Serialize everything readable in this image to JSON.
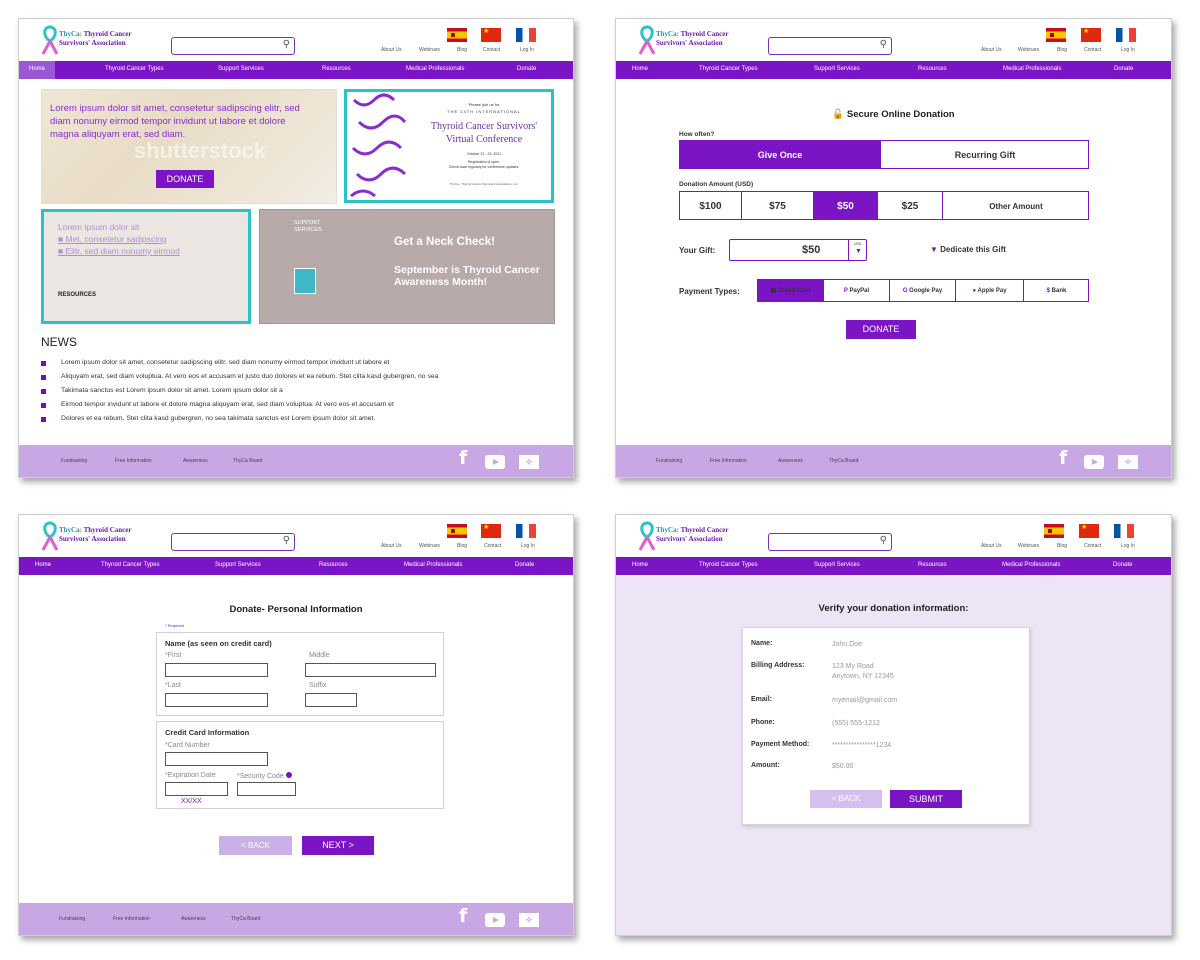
{
  "brand": {
    "logo_line1_a": "ThyCa:",
    "logo_line1_b": "Thyroid Cancer",
    "logo_line2": "Survivors' Association"
  },
  "header": {
    "links": [
      "About Us",
      "Webinars",
      "Blog",
      "Contact",
      "Log In"
    ],
    "flags": [
      "spain-flag",
      "china-flag",
      "france-flag"
    ]
  },
  "nav": {
    "items": [
      "Home",
      "Thyroid Cancer Types",
      "Support Services",
      "Resources",
      "Medical Professionals",
      "Donate"
    ]
  },
  "footer": {
    "links": [
      "Fundraising",
      "Free Information",
      "Awareness",
      "ThyCa Board"
    ],
    "social_icons": [
      "facebook-icon",
      "youtube-icon",
      "twitter-icon"
    ]
  },
  "home": {
    "hero_text": "Lorem ipsum dolor sit amet, consetetur sadipscing elitr, sed diam nonumy eirmod tempor invidunt ut labore et dolore magna aliquyam erat, sed diam.",
    "watermark": "shutterstock",
    "donate": "DONATE",
    "conf_line1": "Please join us for",
    "conf_line2": "THE 24TH INTERNATIONAL",
    "conf_title": "Thyroid Cancer Survivors' Virtual Conference",
    "conf_dates": "October 22 - 24, 2021",
    "conf_reg": "Registration is open.\nCheck back regularly for conference updates.",
    "conf_foot": "ThyCa - Thyroid Cancer Survivors' Association, Inc.",
    "res_line1": "Lorem ipsum dolor sit",
    "res_link1": "Met, consetetur sadipscing",
    "res_link2": "Elitr, sed diam nonumy eirmod",
    "res_label": "RESOURCES",
    "support_label": "SUPPORT SERVICES",
    "neck_check": "Get a Neck Check!",
    "awareness": "September is Thyroid Cancer Awareness Month!",
    "news_title": "NEWS",
    "news": [
      "Lorem ipsum dolor sit amet, consetetur sadipscing elitr, sed diam nonumy eirmod tempor invidunt ut labore et",
      "Aliquyam erat, sed diam voluptua. At vero eos et accusam et justo duo dolores et ea rebum. Stet clita kasd gubergren, no sea",
      "Takimata sanctus est Lorem ipsum dolor sit amet. Lorem ipsum dolor sit a",
      "Eirmod tempor invidunt ut labore et dolore magna aliquyam erat, sed diam voluptua. At vero eos et accusam et",
      "Dolores et ea rebum. Stet clita kasd gubergren, no sea takimata sanctus est Lorem ipsum dolor sit amet."
    ]
  },
  "donate": {
    "title": "Secure Online Donation",
    "how_often": "How often?",
    "frequency": [
      "Give Once",
      "Recurring Gift"
    ],
    "amount_label": "Donation Amount (USD)",
    "amounts": [
      "$100",
      "$75",
      "$50",
      "$25",
      "Other Amount"
    ],
    "selected_amount": "$50",
    "your_gift_label": "Your Gift:",
    "gift_value": "$50",
    "currency": "USD",
    "dedicate": "Dedicate this Gift",
    "payment_label": "Payment Types:",
    "payment_types": [
      "Credit Card",
      "PayPal",
      "Google Pay",
      "Apple Pay",
      "Bank"
    ],
    "button": "DONATE"
  },
  "personal": {
    "title": "Donate- Personal Information",
    "required": "* Required",
    "name_header": "Name (as seen on credit card)",
    "first": "*First",
    "middle": "Middle",
    "last": "*Last",
    "suffix": "Suffix",
    "card_header": "Credit Card Information",
    "card_number": "*Card Number",
    "expiration": "*Expiration Date",
    "security": "*Security Code",
    "exp_placeholder": "XX/XX",
    "back": "< BACK",
    "next": "NEXT >"
  },
  "verify": {
    "title": "Verify your donation information:",
    "rows": [
      {
        "label": "Name:",
        "value": "John Doe"
      },
      {
        "label": "Billing Address:",
        "value": "123 My Road\nAnytown, NY 12345"
      },
      {
        "label": "Email:",
        "value": "myemail@gmail.com"
      },
      {
        "label": "Phone:",
        "value": "(555) 555-1212"
      },
      {
        "label": "Payment Method:",
        "value": "****************1234"
      },
      {
        "label": "Amount:",
        "value": "$50.00"
      }
    ],
    "back": "< BACK",
    "submit": "SUBMIT"
  }
}
